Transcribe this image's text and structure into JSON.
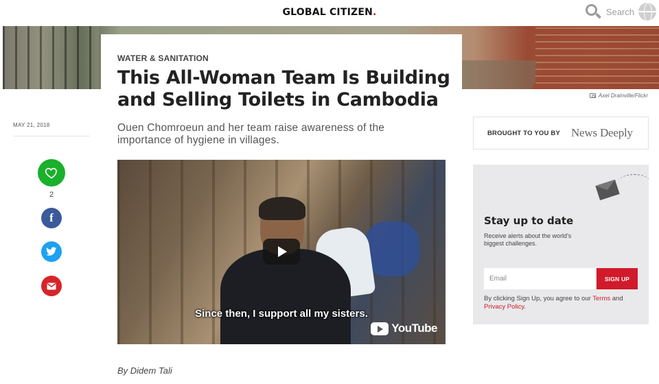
{
  "header": {
    "logo_text": "GLOBAL CITIZEN",
    "logo_dot": ".",
    "search_label": "Search"
  },
  "hero": {
    "photo_credit": "Axel Drainville/Flickr"
  },
  "article": {
    "category": "WATER & SANITATION",
    "headline": "This All-Woman Team Is Building and Selling Toilets in Cambodia",
    "date": "MAY 21, 2018",
    "dek": "Ouen Chomroeun and her team raise awareness of the importance of hygiene in villages.",
    "byline": "By Didem Tali"
  },
  "social": {
    "like_count": "2",
    "facebook_glyph": "f"
  },
  "video": {
    "caption": "Since then, I support all my sisters.",
    "platform": "YouTube"
  },
  "sponsor": {
    "label": "BROUGHT TO YOU BY",
    "brand": "News Deeply"
  },
  "newsletter": {
    "title": "Stay up to date",
    "description": "Receive alerts about the world's biggest challenges.",
    "email_placeholder": "Email",
    "signup_label": "SIGN UP",
    "legal_prefix": "By clicking Sign Up, you agree to our ",
    "terms_label": "Terms",
    "legal_and": " and ",
    "privacy_label": "Privacy Policy",
    "legal_suffix": "."
  },
  "colors": {
    "brand_red": "#d11a2a",
    "like_green": "#19b02b",
    "facebook_blue": "#3b5a9a",
    "twitter_blue": "#1da1f2",
    "email_red": "#d6242a"
  },
  "icons": [
    "search-icon",
    "globe-icon",
    "camera-icon",
    "heart-icon",
    "facebook-icon",
    "twitter-icon",
    "email-icon",
    "play-icon",
    "youtube-icon",
    "mail-icon"
  ]
}
